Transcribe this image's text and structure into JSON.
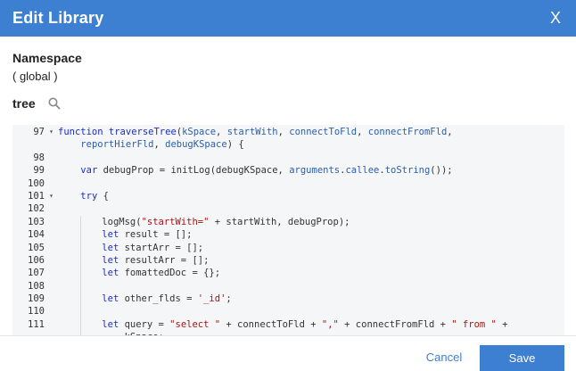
{
  "dialog": {
    "title": "Edit Library",
    "close_label": "X"
  },
  "namespace": {
    "label": "Namespace",
    "value": "( global )"
  },
  "library": {
    "name": "tree"
  },
  "code": {
    "lines": [
      {
        "num": "97",
        "fold": true,
        "indent": 0,
        "segments": [
          [
            "kw",
            "function "
          ],
          [
            "fn",
            "traverseTree"
          ],
          [
            "code",
            "("
          ],
          [
            "param",
            "kSpace"
          ],
          [
            "code",
            ", "
          ],
          [
            "param",
            "startWith"
          ],
          [
            "code",
            ", "
          ],
          [
            "param",
            "connectToFld"
          ],
          [
            "code",
            ", "
          ],
          [
            "param",
            "connectFromFld"
          ],
          [
            "code",
            ","
          ]
        ]
      },
      {
        "num": "",
        "fold": false,
        "indent": 0,
        "segments": [
          [
            "code",
            "    "
          ],
          [
            "param",
            "reportHierFld"
          ],
          [
            "code",
            ", "
          ],
          [
            "param",
            "debugKSpace"
          ],
          [
            "code",
            ") {"
          ]
        ]
      },
      {
        "num": "98",
        "fold": false,
        "indent": 0,
        "segments": []
      },
      {
        "num": "99",
        "fold": false,
        "indent": 0,
        "segments": [
          [
            "code",
            "    "
          ],
          [
            "kw",
            "var "
          ],
          [
            "code",
            "debugProp = initLog(debugKSpace, "
          ],
          [
            "param",
            "arguments"
          ],
          [
            "code",
            "."
          ],
          [
            "param",
            "callee"
          ],
          [
            "code",
            "."
          ],
          [
            "param",
            "toString"
          ],
          [
            "code",
            "());"
          ]
        ]
      },
      {
        "num": "100",
        "fold": false,
        "indent": 0,
        "segments": []
      },
      {
        "num": "101",
        "fold": true,
        "indent": 0,
        "segments": [
          [
            "code",
            "    "
          ],
          [
            "kw",
            "try "
          ],
          [
            "code",
            "{"
          ]
        ]
      },
      {
        "num": "102",
        "fold": false,
        "indent": 0,
        "segments": []
      },
      {
        "num": "103",
        "fold": false,
        "indent": 2,
        "segments": [
          [
            "code",
            "logMsg("
          ],
          [
            "str",
            "\"startWith=\""
          ],
          [
            "code",
            " + startWith, debugProp);"
          ]
        ]
      },
      {
        "num": "104",
        "fold": false,
        "indent": 2,
        "segments": [
          [
            "kw",
            "let "
          ],
          [
            "code",
            "result = [];"
          ]
        ]
      },
      {
        "num": "105",
        "fold": false,
        "indent": 2,
        "segments": [
          [
            "kw",
            "let "
          ],
          [
            "code",
            "startArr = [];"
          ]
        ]
      },
      {
        "num": "106",
        "fold": false,
        "indent": 2,
        "segments": [
          [
            "kw",
            "let "
          ],
          [
            "code",
            "resultArr = [];"
          ]
        ]
      },
      {
        "num": "107",
        "fold": false,
        "indent": 2,
        "segments": [
          [
            "kw",
            "let "
          ],
          [
            "code",
            "fomattedDoc = {};"
          ]
        ]
      },
      {
        "num": "108",
        "fold": false,
        "indent": 2,
        "segments": []
      },
      {
        "num": "109",
        "fold": false,
        "indent": 2,
        "segments": [
          [
            "kw",
            "let "
          ],
          [
            "code",
            "other_flds = "
          ],
          [
            "str",
            "'_id'"
          ],
          [
            "code",
            ";"
          ]
        ]
      },
      {
        "num": "110",
        "fold": false,
        "indent": 2,
        "segments": []
      },
      {
        "num": "111",
        "fold": false,
        "indent": 2,
        "segments": [
          [
            "kw",
            "let "
          ],
          [
            "code",
            "query = "
          ],
          [
            "str",
            "\"select \""
          ],
          [
            "code",
            " + connectToFld + "
          ],
          [
            "str",
            "\",\""
          ],
          [
            "code",
            " + connectFromFld + "
          ],
          [
            "str",
            "\" from \""
          ],
          [
            "code",
            " +"
          ]
        ]
      },
      {
        "num": "",
        "fold": false,
        "indent": 2,
        "segments": [
          [
            "code",
            "    kSpace;"
          ]
        ]
      }
    ]
  },
  "footer": {
    "cancel_label": "Cancel",
    "save_label": "Save"
  },
  "colors": {
    "accent": "#3d7fd0"
  }
}
